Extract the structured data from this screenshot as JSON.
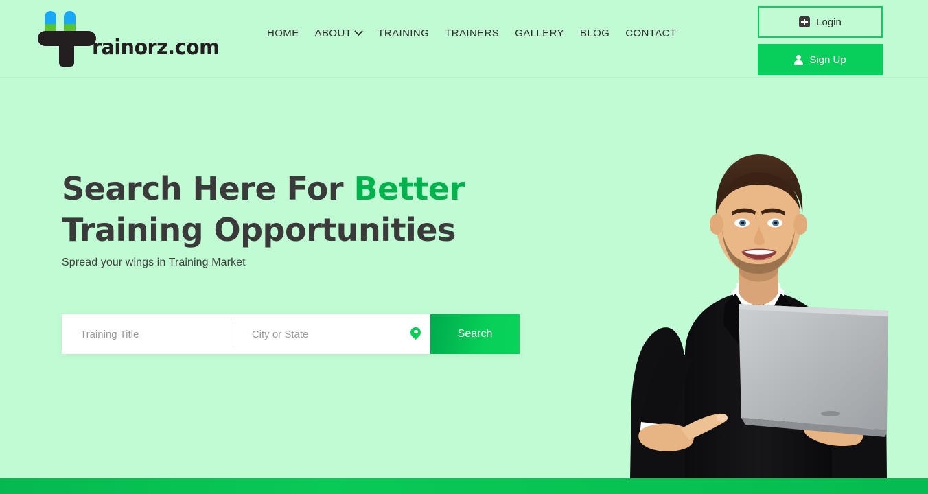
{
  "brand": {
    "logo_text": "rainorz.com",
    "logo_icon": "plug-logo-icon",
    "prong_top_color": "#17a9f5",
    "prong_bottom_color": "#57c52e",
    "logo_mark_color": "#231f20"
  },
  "nav": {
    "items": [
      {
        "label": "HOME",
        "has_dropdown": false
      },
      {
        "label": "ABOUT",
        "has_dropdown": true
      },
      {
        "label": "TRAINING",
        "has_dropdown": false
      },
      {
        "label": "TRAINERS",
        "has_dropdown": false
      },
      {
        "label": "GALLERY",
        "has_dropdown": false
      },
      {
        "label": "BLOG",
        "has_dropdown": false
      },
      {
        "label": "CONTACT",
        "has_dropdown": false
      }
    ]
  },
  "auth": {
    "login_label": "Login",
    "login_icon": "plus-square-icon",
    "signup_label": "Sign Up",
    "signup_icon": "user-icon"
  },
  "hero": {
    "headline_part1": "Search Here For ",
    "headline_accent": "Better",
    "headline_part2": "Training Opportunities",
    "subtitle": "Spread your wings in Training Market",
    "image_alt": "Smiling businessman in black suit pointing at a silver laptop"
  },
  "search": {
    "title_placeholder": "Training Title",
    "title_value": "",
    "location_placeholder": "City or State",
    "location_value": "",
    "location_icon": "map-pin-icon",
    "button_label": "Search"
  },
  "colors": {
    "background": "#c1fbd3",
    "accent_green": "#00b24b",
    "button_green": "#08cf5c",
    "heading_dark": "#3a3a3a",
    "bottom_strip": "#07c252"
  }
}
